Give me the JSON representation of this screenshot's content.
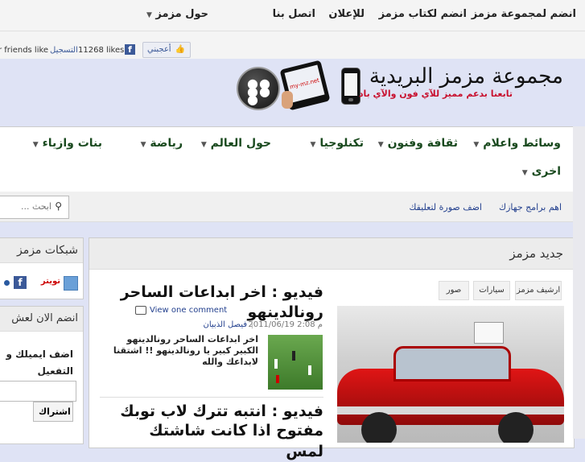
{
  "topnav": {
    "items": [
      "انضم لمجموعة مزمز",
      "انضم لكتاب مزمز",
      "للإعلان",
      "اتصل بنا",
      "حول مزمز"
    ]
  },
  "social": {
    "friends_text": "r friends like",
    "register": "التسجيل",
    "likes": "11268 likes.",
    "like_button": "أعجبني"
  },
  "header": {
    "title": "مجموعة مزمز البريدية",
    "subtitle": "تابعنا بدعم مميز للآي فون والآي باد",
    "tablet_text": "my-mz.net"
  },
  "nav": {
    "row1": [
      "وسائط واعلام",
      "ثقافة وفنون",
      "تكنلوجيا",
      "حول العالم",
      "رياضة",
      "بنات وازياء"
    ],
    "row2": [
      "اخرى"
    ]
  },
  "subnav": {
    "links": [
      "اهم برامج جهازك",
      "اضف صورة لتعليقك"
    ],
    "search_placeholder": "ابحث ..."
  },
  "sidebar": {
    "networks_title": "شبكات مزمز",
    "twitter": "تويتر",
    "join_title": "انضم الان لعش",
    "email_prompt_1": "اضف ايميلك و",
    "email_prompt_2": "التفعيل",
    "subscribe": "اشتراك"
  },
  "main": {
    "heading": "جديد مزمز",
    "tags": [
      "ارشيف مزمز",
      "سيارات",
      "صور"
    ],
    "article1": {
      "title_1": "فيديو : اخر ابداعات الساحر",
      "title_2": "رونالدينهو",
      "comments": "View one comment",
      "meta_date": "2011/06/19 2:08 م",
      "meta_author": "فيصل الذبيان",
      "excerpt_1": "اخر ابداعات الساحر رونالدينهو",
      "excerpt_2": "الكبير كبير يا رونالدينهو !! اشتقنا",
      "excerpt_3": "لابداعك والله"
    },
    "article2": {
      "title_1": "فيديو : انتبه تترك لاب توبك",
      "title_2": "مفتوح اذا كانت شاشتك لمس"
    }
  },
  "colors": {
    "page_bg": "#dfe3f5",
    "nav_text": "#1a4a1f",
    "link": "#23408e",
    "subtitle": "#c8102e"
  }
}
